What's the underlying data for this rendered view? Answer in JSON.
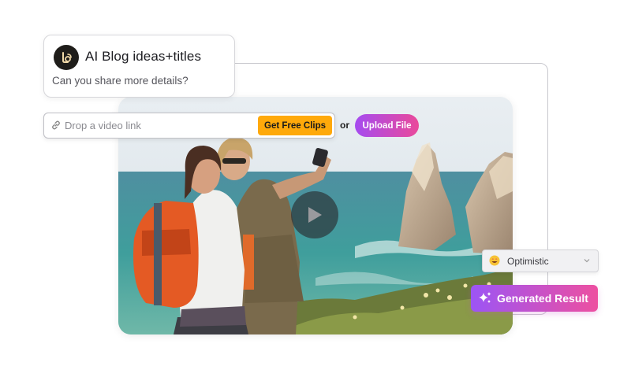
{
  "chat": {
    "title": "AI Blog ideas+titles",
    "subtitle": "Can you share more details?",
    "avatar_icon": "logo-icon"
  },
  "link_bar": {
    "placeholder": "Drop a video link",
    "icon": "link-icon",
    "clips_button_label": "Get Free Clips"
  },
  "or_label": "or",
  "upload_button_label": "Upload File",
  "video": {
    "play_icon": "play-icon"
  },
  "tone": {
    "selected": "Optimistic",
    "icon": "smiling-face-emoji-icon"
  },
  "generate": {
    "label": "Generated Result",
    "icon": "sparkle-icon"
  },
  "colors": {
    "clips_button": "#ffa90a",
    "gradient_start": "#a54bf0",
    "gradient_end": "#ea4a9a"
  }
}
